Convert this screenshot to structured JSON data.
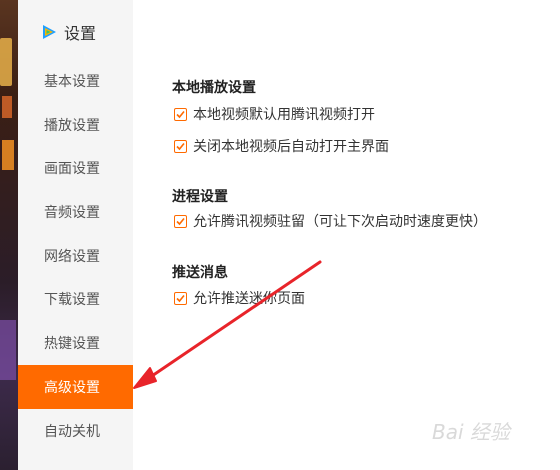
{
  "sidebar": {
    "title": "设置",
    "items": [
      {
        "label": "基本设置",
        "active": false
      },
      {
        "label": "播放设置",
        "active": false
      },
      {
        "label": "画面设置",
        "active": false
      },
      {
        "label": "音频设置",
        "active": false
      },
      {
        "label": "网络设置",
        "active": false
      },
      {
        "label": "下载设置",
        "active": false
      },
      {
        "label": "热键设置",
        "active": false
      },
      {
        "label": "高级设置",
        "active": true
      },
      {
        "label": "自动关机",
        "active": false
      }
    ]
  },
  "sections": [
    {
      "title": "本地播放设置",
      "options": [
        {
          "label": "本地视频默认用腾讯视频打开",
          "checked": true
        },
        {
          "label": "关闭本地视频后自动打开主界面",
          "checked": true
        }
      ]
    },
    {
      "title": "进程设置",
      "options": [
        {
          "label": "允许腾讯视频驻留（可让下次启动时速度更快）",
          "checked": true
        }
      ]
    },
    {
      "title": "推送消息",
      "options": [
        {
          "label": "允许推送迷你页面",
          "checked": true
        }
      ]
    }
  ],
  "watermark": {
    "text": "Bai 经验"
  },
  "colors": {
    "accent": "#ff6a00",
    "arrow": "#e8242a",
    "sidebar_bg": "#f5f5f5"
  }
}
